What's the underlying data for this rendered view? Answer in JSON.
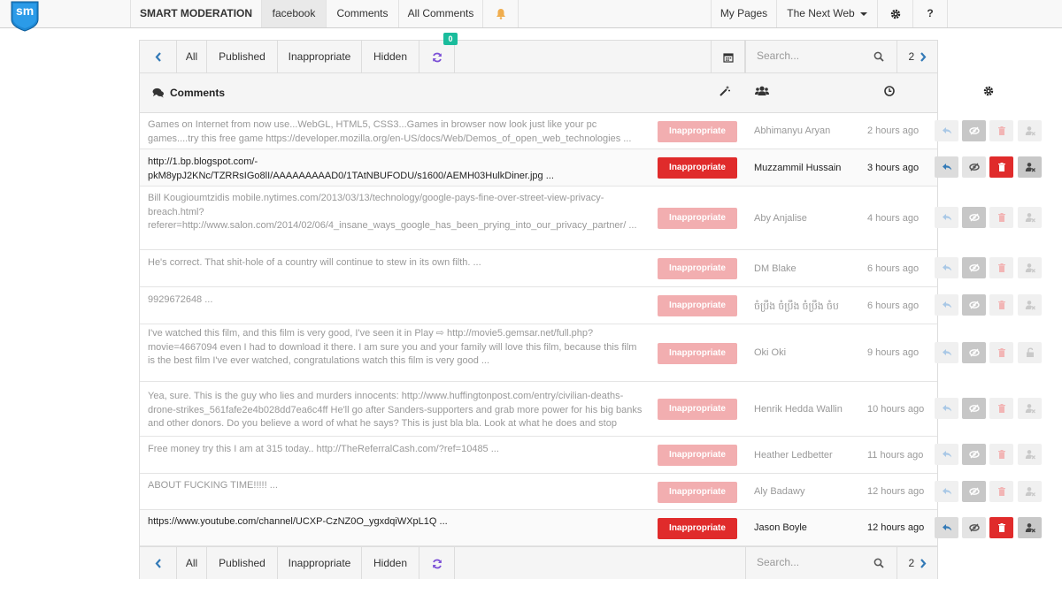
{
  "topnav": {
    "logo_text": "sm",
    "brand": "SMART MODERATION",
    "items": [
      "facebook",
      "Comments",
      "All Comments"
    ],
    "my_pages": "My Pages",
    "page_select": "The Next Web"
  },
  "toolbar": {
    "tabs": [
      "All",
      "Published",
      "Inappropriate",
      "Hidden"
    ],
    "new_count": "0",
    "search_placeholder": "Search...",
    "page_number": "2"
  },
  "table": {
    "title": "Comments",
    "rows": [
      {
        "text": "Games on Internet from now use...WebGL, HTML5, CSS3...Games in browser now look just like your pc games....try this free game https://developer.mozilla.org/en-US/docs/Web/Demos_of_open_web_technologies ...",
        "status": "Inappropriate",
        "author": "Abhimanyu Aryan",
        "time": "2 hours ago",
        "active": false
      },
      {
        "text": "http://1.bp.blogspot.com/-pkM8ypJ2KNc/TZRRsIGo8lI/AAAAAAAAAD0/1TAtNBUFODU/s1600/AEMH03HulkDiner.jpg ...",
        "status": "Inappropriate",
        "author": "Muzzammil Hussain",
        "time": "3 hours ago",
        "active": true
      },
      {
        "text": "Bill Kougioumtzidis mobile.nytimes.com/2013/03/13/technology/google-pays-fine-over-street-view-privacy-breach.html?referer=http://www.salon.com/2014/02/06/4_insane_ways_google_has_been_prying_into_our_privacy_partner/ ...",
        "status": "Inappropriate",
        "author": "Aby Anjalise",
        "time": "4 hours ago",
        "active": false
      },
      {
        "text": "He's correct. That shit-hole of a country will continue to stew in its own filth. ...",
        "status": "Inappropriate",
        "author": "DM Blake",
        "time": "6 hours ago",
        "active": false
      },
      {
        "text": "9929672648 ...",
        "status": "Inappropriate",
        "author": "ចំប្រឹង ចំប្រឹង ចំប្រឹង ចំប",
        "time": "6 hours ago",
        "active": false
      },
      {
        "text": "I've watched this film, and this film is very good, I've seen it in Play ⇨ http://movie5.gemsar.net/full.php?movie=4667094 even I had to download it there. I am sure you and your family will love this film, because this film is the best film I've ever watched, congratulations watch this film is very good ...",
        "status": "Inappropriate",
        "author": "Oki Oki",
        "time": "9 hours ago",
        "active": false
      },
      {
        "text": "Yea, sure. This is the guy who lies and murders innocents: http://www.huffingtonpost.com/entry/civilian-deaths-drone-strikes_561fafe2e4b028dd7ea6c4ff He'll go after Sanders-supporters and grab more power for his big banks and other donors. Do you believe a word of what he says? This is just bla bla. Look at what he does and stop listening to him! ...",
        "status": "Inappropriate",
        "author": "Henrik Hedda Wallin",
        "time": "10 hours ago",
        "active": false
      },
      {
        "text": "Free money try this I am at 315 today.. http://TheReferralCash.com/?ref=10485 ...",
        "status": "Inappropriate",
        "author": "Heather Ledbetter",
        "time": "11 hours ago",
        "active": false
      },
      {
        "text": "ABOUT FUCKING TIME!!!!! ...",
        "status": "Inappropriate",
        "author": "Aly Badawy",
        "time": "12 hours ago",
        "active": false
      },
      {
        "text": "https://www.youtube.com/channel/UCXP-CzNZ0O_ygxdqiWXpL1Q ...",
        "status": "Inappropriate",
        "author": "Jason Boyle",
        "time": "12 hours ago",
        "active": true
      }
    ]
  },
  "colors": {
    "accent_blue": "#337ab7",
    "danger_red": "#e02b2b",
    "danger_faded": "#f2aeb0",
    "teal_badge": "#1abc9c",
    "bell_yellow": "#f0ad4e",
    "refresh_purple": "#7b4fd6"
  },
  "icons": [
    "chevron-left-icon",
    "chevron-right-icon",
    "bell-icon",
    "gear-icon",
    "question-icon",
    "refresh-icon",
    "calendar-icon",
    "search-icon",
    "comments-icon",
    "wand-icon",
    "users-icon",
    "clock-icon",
    "reply-icon",
    "eye-slash-icon",
    "trash-icon",
    "user-ban-icon",
    "unlock-icon"
  ]
}
